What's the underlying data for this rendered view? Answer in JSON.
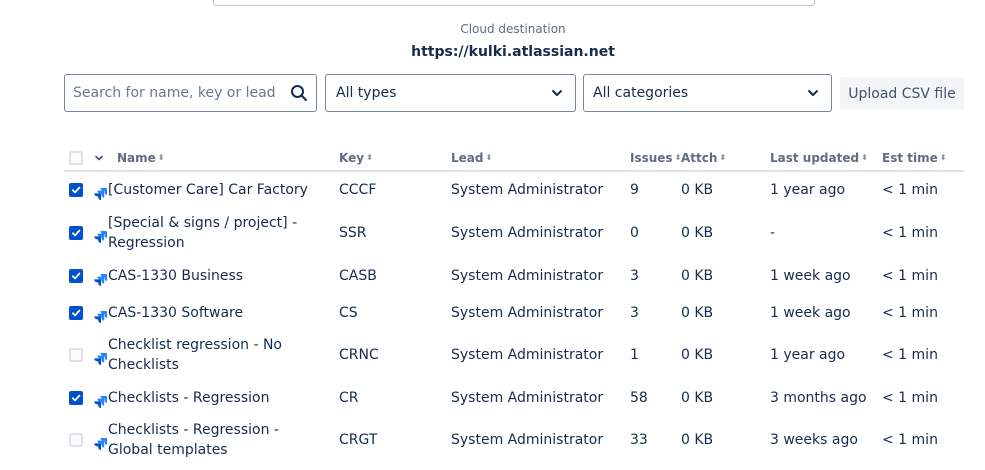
{
  "destination": {
    "label": "Cloud destination",
    "url": "https://kulki.atlassian.net"
  },
  "filters": {
    "search_placeholder": "Search for name, key or lead",
    "types_value": "All types",
    "categories_value": "All categories",
    "upload_label": "Upload CSV file"
  },
  "table": {
    "headers": {
      "name": "Name",
      "key": "Key",
      "lead": "Lead",
      "issues": "Issues",
      "attch": "Attch",
      "updated": "Last updated",
      "est": "Est time"
    },
    "rows": [
      {
        "checked": true,
        "name": "[Customer Care] Car Factory",
        "key": "CCCF",
        "lead": "System Administrator",
        "issues": "9",
        "attch": "0 KB",
        "updated": "1 year ago",
        "est": "< 1 min"
      },
      {
        "checked": true,
        "name": "[Special & signs / project] - Regression",
        "key": "SSR",
        "lead": "System Administrator",
        "issues": "0",
        "attch": "0 KB",
        "updated": "-",
        "est": "< 1 min"
      },
      {
        "checked": true,
        "name": "CAS-1330 Business",
        "key": "CASB",
        "lead": "System Administrator",
        "issues": "3",
        "attch": "0 KB",
        "updated": "1 week ago",
        "est": "< 1 min"
      },
      {
        "checked": true,
        "name": "CAS-1330 Software",
        "key": "CS",
        "lead": "System Administrator",
        "issues": "3",
        "attch": "0 KB",
        "updated": "1 week ago",
        "est": "< 1 min"
      },
      {
        "checked": false,
        "name": "Checklist regression - No Checklists",
        "key": "CRNC",
        "lead": "System Administrator",
        "issues": "1",
        "attch": "0 KB",
        "updated": "1 year ago",
        "est": "< 1 min"
      },
      {
        "checked": true,
        "name": "Checklists - Regression",
        "key": "CR",
        "lead": "System Administrator",
        "issues": "58",
        "attch": "0 KB",
        "updated": "3 months ago",
        "est": "< 1 min"
      },
      {
        "checked": false,
        "name": "Checklists - Regression - Global templates",
        "key": "CRGT",
        "lead": "System Administrator",
        "issues": "33",
        "attch": "0 KB",
        "updated": "3 weeks ago",
        "est": "< 1 min"
      }
    ]
  },
  "colors": {
    "checkbox_checked": "#0052cc",
    "project_icon": "#2684ff"
  },
  "icons": {
    "search": "search-icon",
    "dropdown": "chevron-down-icon",
    "project": "jira-software-project-icon",
    "sort": "sort-icon",
    "check": "check-icon"
  }
}
